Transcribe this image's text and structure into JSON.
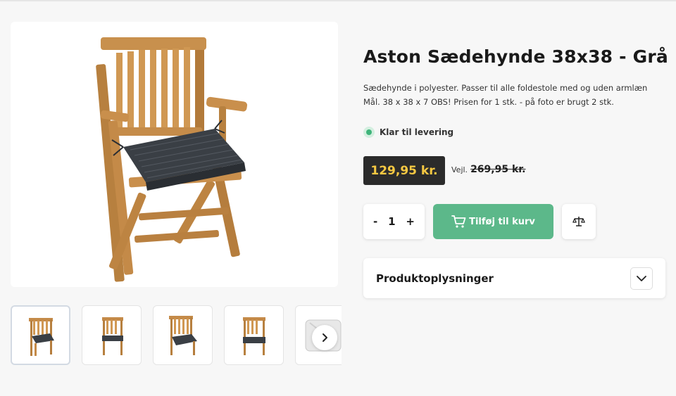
{
  "product": {
    "title": "Aston Sædehynde 38x38 - Grå",
    "description": "Sædehynde i polyester. Passer til alle foldestole med og uden armlæn Mål. 38 x 38 x 7 OBS! Prisen for 1 stk. - på foto er brugt 2 stk.",
    "stock_status": "Klar til levering",
    "price": "129,95 kr.",
    "rrp_label": "Vejl.",
    "rrp_value": "269,95 kr."
  },
  "quantity": {
    "minus": "-",
    "value": "1",
    "plus": "+"
  },
  "actions": {
    "add_to_cart": "Tilføj til kurv",
    "cart_icon": "cart-icon",
    "compare_icon": "scale-icon"
  },
  "accordion": {
    "label": "Produktoplysninger",
    "toggle_icon": "chevron-down-icon"
  },
  "gallery": {
    "next_icon": "chevron-right-icon",
    "thumbnail_count": 5
  },
  "colors": {
    "accent_green": "#5cb88a",
    "price_bg": "#2b2b2b",
    "price_text": "#f5c842",
    "stock_green": "#3fb47a"
  }
}
